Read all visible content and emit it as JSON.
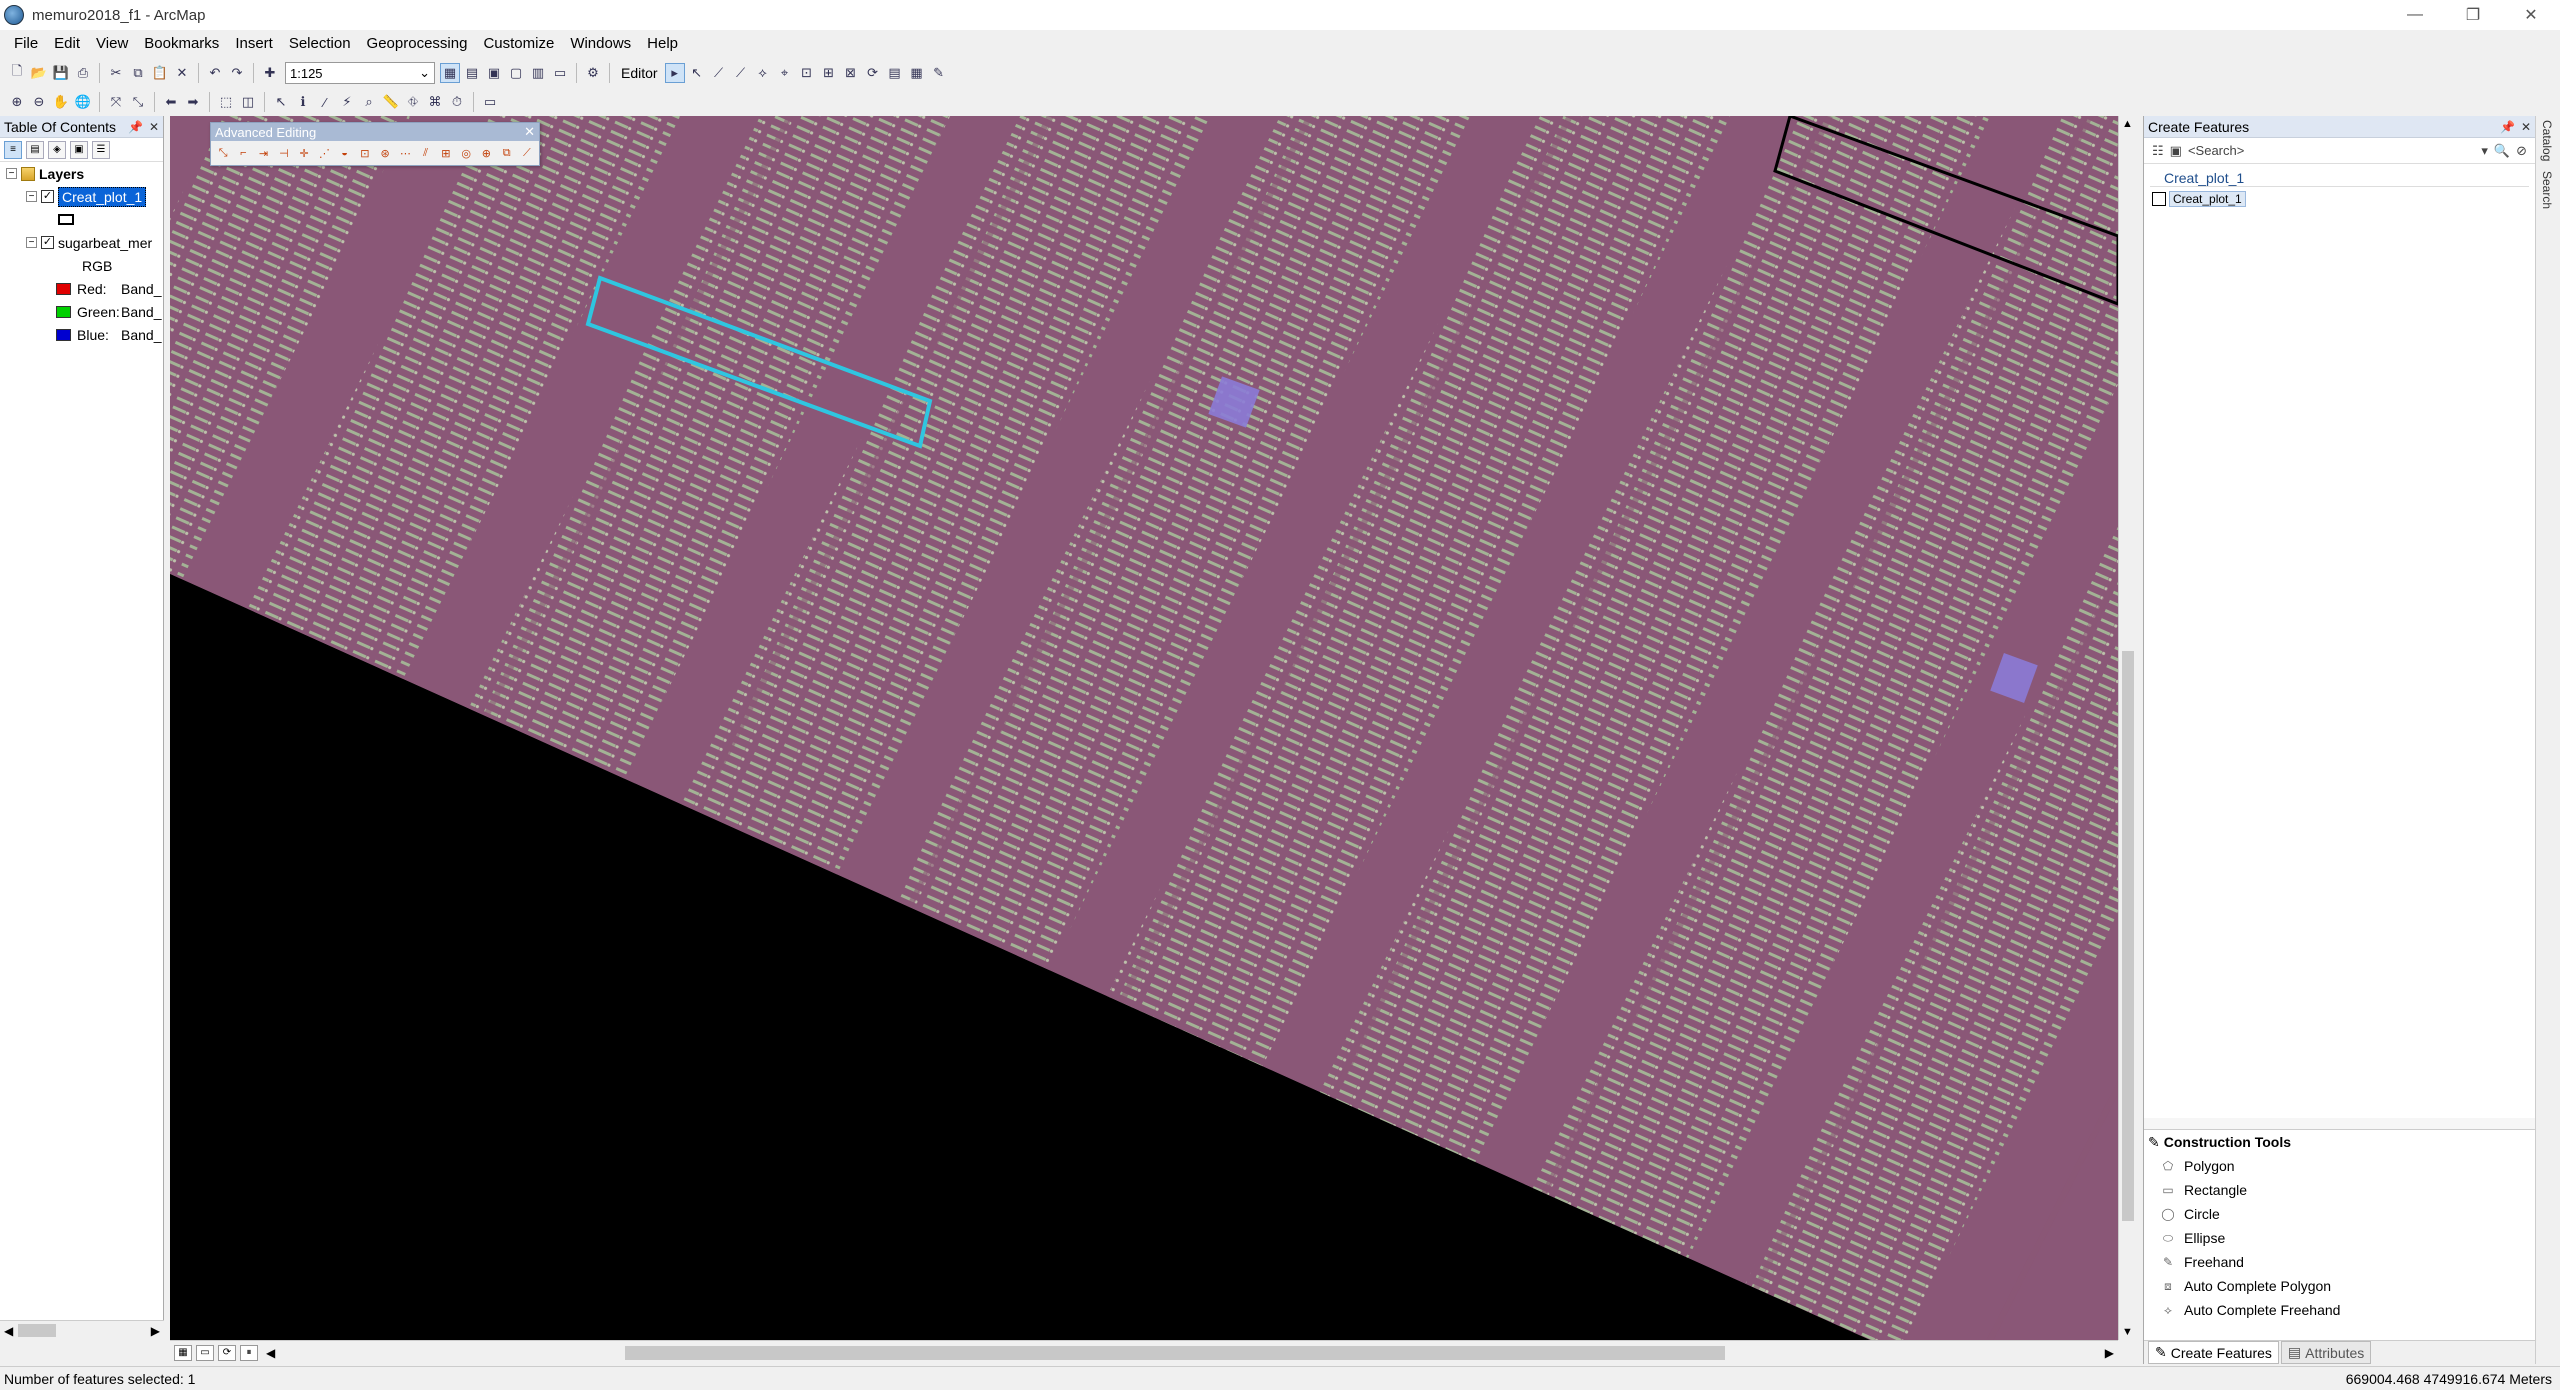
{
  "window": {
    "title": "memuro2018_f1 - ArcMap",
    "controls": [
      "—",
      "❐",
      "✕"
    ]
  },
  "menu": [
    "File",
    "Edit",
    "View",
    "Bookmarks",
    "Insert",
    "Selection",
    "Geoprocessing",
    "Customize",
    "Windows",
    "Help"
  ],
  "toolbar": {
    "scale_value": "1:125",
    "editor_label": "Editor"
  },
  "toc": {
    "title": "Table Of Contents",
    "root_label": "Layers",
    "layer1_label": "Creat_plot_1",
    "layer2_label": "sugarbeat_mer",
    "rgb_label": "RGB",
    "bands": [
      {
        "label": "Red:",
        "value": "Band_",
        "color": "#e00000"
      },
      {
        "label": "Green:",
        "value": "Band_",
        "color": "#00d000"
      },
      {
        "label": "Blue:",
        "value": "Band_",
        "color": "#0000d0"
      }
    ]
  },
  "adv_editing": {
    "title": "Advanced Editing"
  },
  "map": {
    "field_color": "#8a5777",
    "cyan_box_color": "#2fc6e0"
  },
  "create_features": {
    "title": "Create Features",
    "search_placeholder": "<Search>",
    "group_label": "Creat_plot_1",
    "template_label": "Creat_plot_1"
  },
  "construction_tools": {
    "title": "Construction Tools",
    "items": [
      "Polygon",
      "Rectangle",
      "Circle",
      "Ellipse",
      "Freehand",
      "Auto Complete Polygon",
      "Auto Complete Freehand"
    ]
  },
  "right_tabs": {
    "create_features": "Create Features",
    "attributes": "Attributes"
  },
  "side_tabs": {
    "catalog": "Catalog",
    "search": "Search"
  },
  "status": {
    "selected": "Number of features selected: 1",
    "coords": "669004.468  4749916.674 Meters"
  }
}
